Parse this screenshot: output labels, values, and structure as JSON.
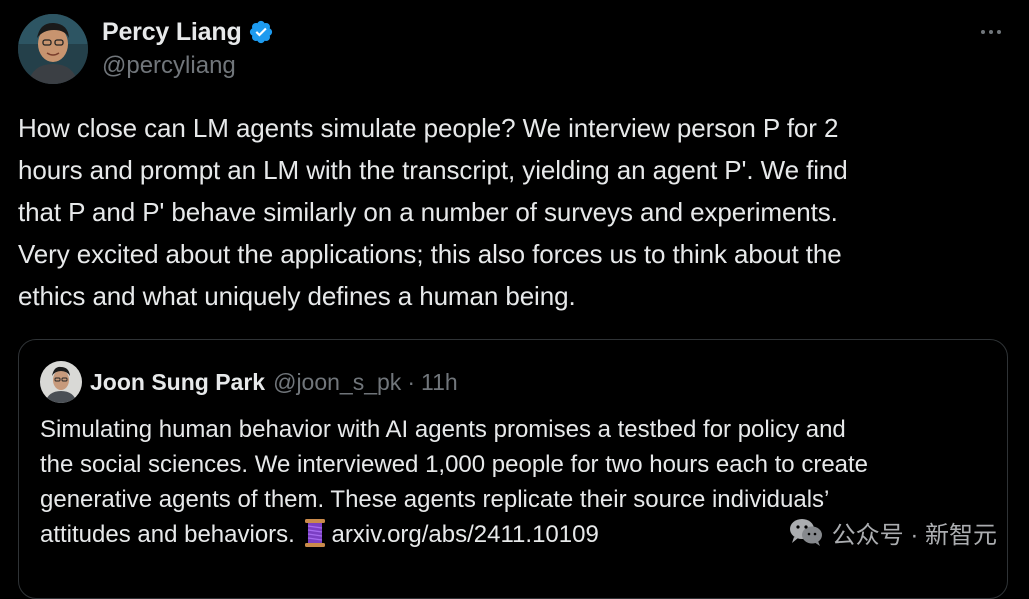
{
  "tweet": {
    "author": {
      "name": "Percy Liang",
      "handle": "@percyliang",
      "avatar_icon": "person-avatar-photo",
      "verified": true,
      "verified_color": "#1d9bf0"
    },
    "more_icon": "ellipsis-icon",
    "text": "How close can LM agents simulate people? We interview person P for 2\nhours and prompt an LM with the transcript, yielding an agent P'. We find\nthat P and P' behave similarly on a number of surveys and experiments.\nVery excited about the applications; this also forces us to think about the\nethics and what uniquely defines a human being."
  },
  "quote": {
    "author": {
      "name": "Joon Sung Park",
      "handle": "@joon_s_pk",
      "separator": "·",
      "time": "11h",
      "avatar_icon": "person-avatar-photo"
    },
    "text": "Simulating human behavior with AI agents promises a testbed for policy and\nthe social sciences. We interviewed 1,000 people for two hours each to create\ngenerative agents of them. These agents replicate their source individuals’\nattitudes and behaviors.",
    "thread_icon": "thread-spool-emoji",
    "link": "arxiv.org/abs/2411.10109"
  },
  "watermark": {
    "icon": "wechat-icon",
    "text": "公众号 · 新智元"
  },
  "colors": {
    "background": "#000000",
    "primary_text": "#e7e9ea",
    "secondary_text": "#71767b",
    "border": "#2f3336",
    "verified": "#1d9bf0"
  }
}
